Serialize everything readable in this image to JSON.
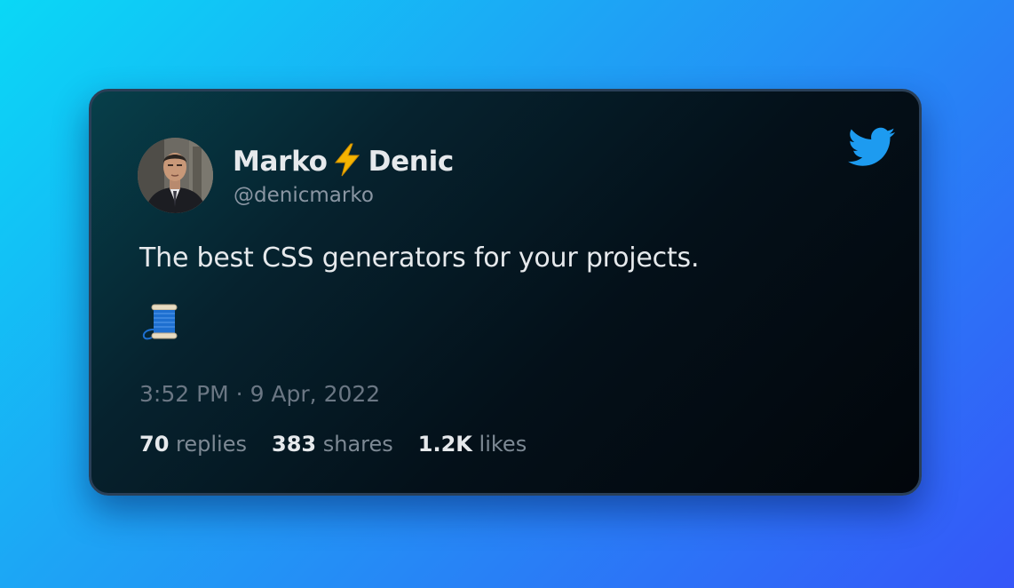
{
  "tweet": {
    "author": {
      "first_name": "Marko",
      "last_name": "Denic",
      "handle": "@denicmarko",
      "name_icon": "lightning-bolt-icon"
    },
    "text": "The best CSS generators for your projects.",
    "emoji_icon": "thread-spool-icon",
    "timestamp": "3:52 PM · 9 Apr, 2022",
    "stats": {
      "replies_count": "70",
      "replies_label": "replies",
      "shares_count": "383",
      "shares_label": "shares",
      "likes_count": "1.2K",
      "likes_label": "likes"
    },
    "brand_icon": "twitter-bird-icon"
  },
  "colors": {
    "twitter_blue": "#1d9bf0",
    "text_primary": "#e6e9ec",
    "text_secondary": "#8a96a3",
    "card_border": "#2a3f57"
  }
}
